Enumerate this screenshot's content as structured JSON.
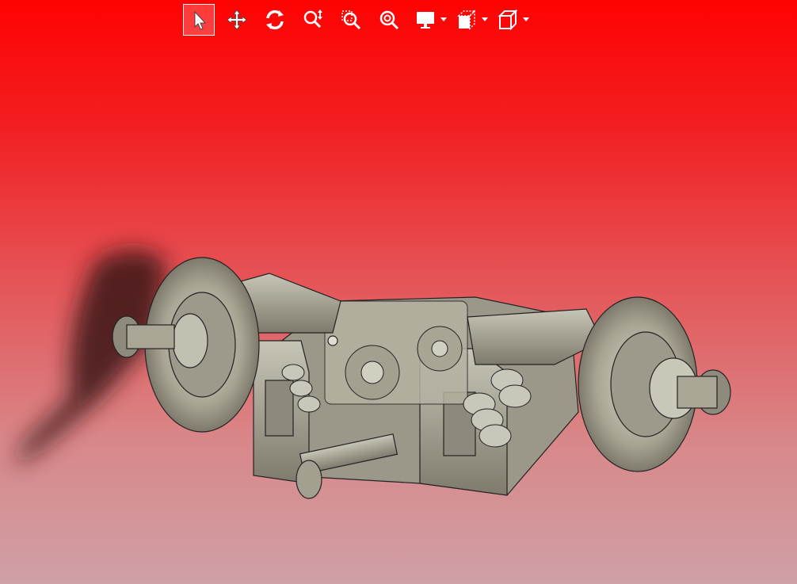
{
  "app": {
    "accent": "#ff0202",
    "background_top": "#ff0202",
    "background_bottom": "#cfa0a6"
  },
  "toolbar": {
    "buttons": [
      {
        "icon": "cursor-select-icon",
        "active": true
      },
      {
        "icon": "pan-move-icon",
        "active": false
      },
      {
        "icon": "rotate-orbit-icon",
        "active": false
      },
      {
        "icon": "zoom-icon",
        "active": false
      },
      {
        "icon": "zoom-window-icon",
        "active": false
      },
      {
        "icon": "zoom-fit-icon",
        "active": false
      },
      {
        "icon": "display-monitor-icon",
        "active": false,
        "has_dropdown": true
      },
      {
        "icon": "section-view-icon",
        "active": false,
        "has_dropdown": true
      },
      {
        "icon": "view-cube-icon",
        "active": false,
        "has_dropdown": true
      }
    ]
  },
  "scene": {
    "model_color": "#aaa796",
    "edge_color": "#222222",
    "shadow_color": "#3a1818"
  }
}
